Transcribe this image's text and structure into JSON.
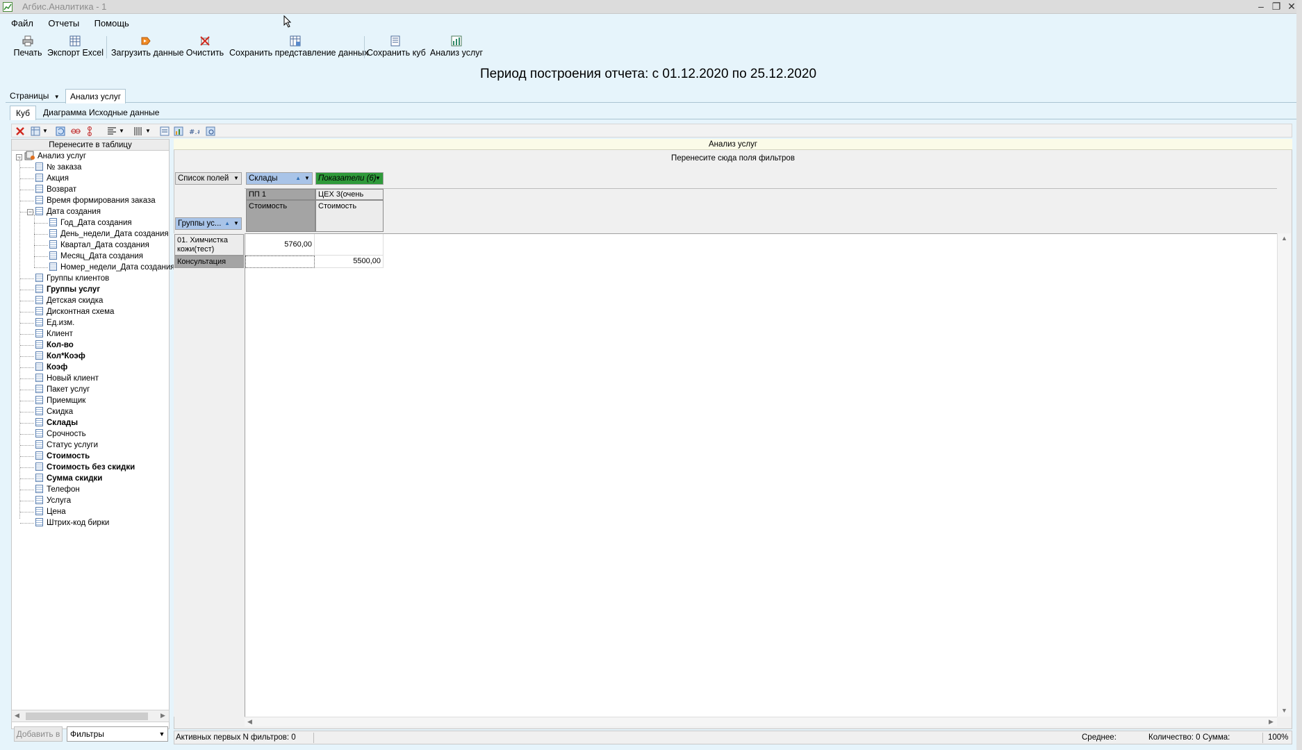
{
  "window": {
    "title": "Агбис.Аналитика - 1",
    "controls": [
      "–",
      "❐",
      "✕"
    ]
  },
  "menu": [
    "Файл",
    "Отчеты",
    "Помощь"
  ],
  "toolbar": [
    {
      "label": "Печать",
      "icon": "printer-icon"
    },
    {
      "label": "Экспорт Excel",
      "icon": "excel-export-icon"
    },
    {
      "label": "Загрузить данные",
      "icon": "load-data-icon"
    },
    {
      "label": "Очистить",
      "icon": "clear-icon"
    },
    {
      "label": "Сохранить представление данных",
      "icon": "save-view-icon"
    },
    {
      "label": "Сохранить куб",
      "icon": "save-cube-icon"
    },
    {
      "label": "Анализ услуг",
      "icon": "chart-icon"
    }
  ],
  "period": "Период построения отчета: с 01.12.2020 по 25.12.2020",
  "pages_tab": "Страницы",
  "page_tab": "Анализ услуг",
  "inner_tabs": [
    "Куб",
    "Диаграмма",
    "Исходные данные"
  ],
  "left_panel": {
    "header": "Перенесите в таблицу",
    "root": "Анализ услуг",
    "fields": [
      {
        "label": "№ заказа",
        "bold": false,
        "level": 1
      },
      {
        "label": "Акция",
        "bold": false,
        "level": 1
      },
      {
        "label": "Возврат",
        "bold": false,
        "level": 1
      },
      {
        "label": "Время формирования заказа",
        "bold": false,
        "level": 1
      },
      {
        "label": "Дата создания",
        "bold": false,
        "level": 1,
        "expanded": true
      },
      {
        "label": "Год_Дата создания",
        "bold": false,
        "level": 2
      },
      {
        "label": "День_недели_Дата создания",
        "bold": false,
        "level": 2
      },
      {
        "label": "Квартал_Дата создания",
        "bold": false,
        "level": 2
      },
      {
        "label": "Месяц_Дата создания",
        "bold": false,
        "level": 2
      },
      {
        "label": "Номер_недели_Дата создания",
        "bold": false,
        "level": 2
      },
      {
        "label": "Группы клиентов",
        "bold": false,
        "level": 1
      },
      {
        "label": "Группы услуг",
        "bold": true,
        "level": 1
      },
      {
        "label": "Детская скидка",
        "bold": false,
        "level": 1
      },
      {
        "label": "Дисконтная схема",
        "bold": false,
        "level": 1
      },
      {
        "label": "Ед.изм.",
        "bold": false,
        "level": 1
      },
      {
        "label": "Клиент",
        "bold": false,
        "level": 1
      },
      {
        "label": "Кол-во",
        "bold": true,
        "level": 1
      },
      {
        "label": "Кол*Коэф",
        "bold": true,
        "level": 1
      },
      {
        "label": "Коэф",
        "bold": true,
        "level": 1
      },
      {
        "label": "Новый клиент",
        "bold": false,
        "level": 1
      },
      {
        "label": "Пакет услуг",
        "bold": false,
        "level": 1
      },
      {
        "label": "Приемщик",
        "bold": false,
        "level": 1
      },
      {
        "label": "Скидка",
        "bold": false,
        "level": 1
      },
      {
        "label": "Склады",
        "bold": true,
        "level": 1
      },
      {
        "label": "Срочность",
        "bold": false,
        "level": 1
      },
      {
        "label": "Статус услуги",
        "bold": false,
        "level": 1
      },
      {
        "label": "Стоимость",
        "bold": true,
        "level": 1
      },
      {
        "label": "Стоимость без скидки",
        "bold": true,
        "level": 1
      },
      {
        "label": "Сумма скидки",
        "bold": true,
        "level": 1
      },
      {
        "label": "Телефон",
        "bold": false,
        "level": 1
      },
      {
        "label": "Услуга",
        "bold": false,
        "level": 1
      },
      {
        "label": "Цена",
        "bold": false,
        "level": 1
      },
      {
        "label": "Штрих-код бирки",
        "bold": false,
        "level": 1
      }
    ],
    "add_button": "Добавить в",
    "add_target": "Фильтры"
  },
  "pivot": {
    "title": "Анализ услуг",
    "filter_drop": "Перенесите сюда поля фильтров",
    "field_list_btn": "Список полей",
    "col_field": "Склады",
    "measures_btn": "Показатели (6)",
    "row_field": "Группы ус...",
    "columns": [
      {
        "warehouse": "ПП 1",
        "measure": "Стоимость"
      },
      {
        "warehouse": "ЦЕХ 3(очень",
        "measure": "Стоимость"
      }
    ],
    "rows": [
      {
        "label": "01. Химчистка кожи(тест)",
        "values": [
          "5760,00",
          ""
        ]
      },
      {
        "label": "Консультация",
        "values": [
          "",
          "5500,00"
        ]
      }
    ]
  },
  "status": {
    "filters": "Активных первых N фильтров: 0",
    "avg": "Среднее:",
    "count": "Количество: 0",
    "sum": "Сумма:",
    "zoom": "100%"
  },
  "colors": {
    "app_bg": "#e6f4fb",
    "measures_green": "#2f9a3a",
    "field_blue": "#a9c4e8"
  }
}
